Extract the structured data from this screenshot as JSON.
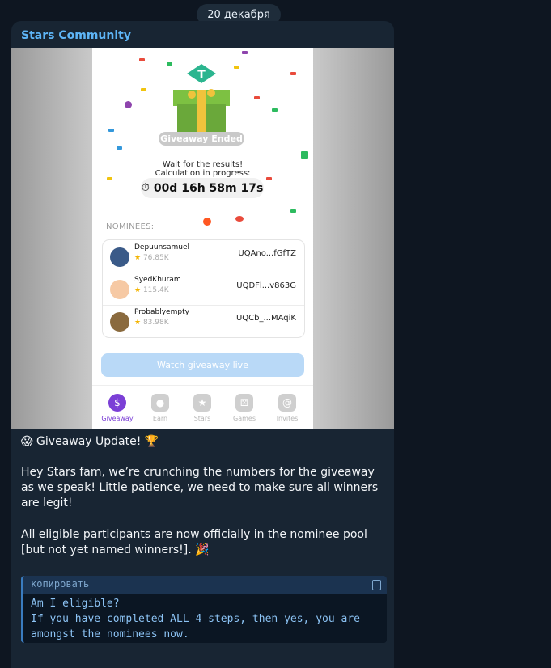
{
  "date_separator": "20 декабря",
  "message": {
    "sender": "Stars Community",
    "screenshot": {
      "status": "Giveaway Ended",
      "wait_line1": "Wait for the results!",
      "wait_line2": "Calculation in progress:",
      "timer": "00d 16h 58m 17s",
      "nominees_label": "NOMINEES:",
      "nominees": [
        {
          "name": "Depuunsamuel",
          "stars": "76.85K",
          "address": "UQAno...fGfTZ"
        },
        {
          "name": "SyedKhuram",
          "stars": "115.4K",
          "address": "UQDFl...v863G"
        },
        {
          "name": "Probablyempty",
          "stars": "83.98K",
          "address": "UQCb_...MAqiK"
        }
      ],
      "watch_button": "Watch giveaway live",
      "tabs": [
        {
          "label": "Giveaway",
          "icon": "dollar-icon",
          "glyph": "$"
        },
        {
          "label": "Earn",
          "icon": "bag-icon",
          "glyph": "●"
        },
        {
          "label": "Stars",
          "icon": "star-icon",
          "glyph": "★"
        },
        {
          "label": "Games",
          "icon": "dice-icon",
          "glyph": "⚄"
        },
        {
          "label": "Invites",
          "icon": "at-icon",
          "glyph": "@"
        }
      ]
    },
    "heading": "😱 Giveaway Update! 🏆",
    "paragraph1": "Hey Stars fam, we’re crunching the numbers for the giveaway as we speak! Little patience, we need to make sure all winners are legit!",
    "paragraph2": "All eligible participants are now officially in the nominee pool [but not yet named winners!]. 🎉",
    "code": {
      "copy_label": "копировать",
      "text": "Am I eligible?\nIf you have completed ALL 4 steps, then yes, you are\namongst the nominees now."
    }
  }
}
